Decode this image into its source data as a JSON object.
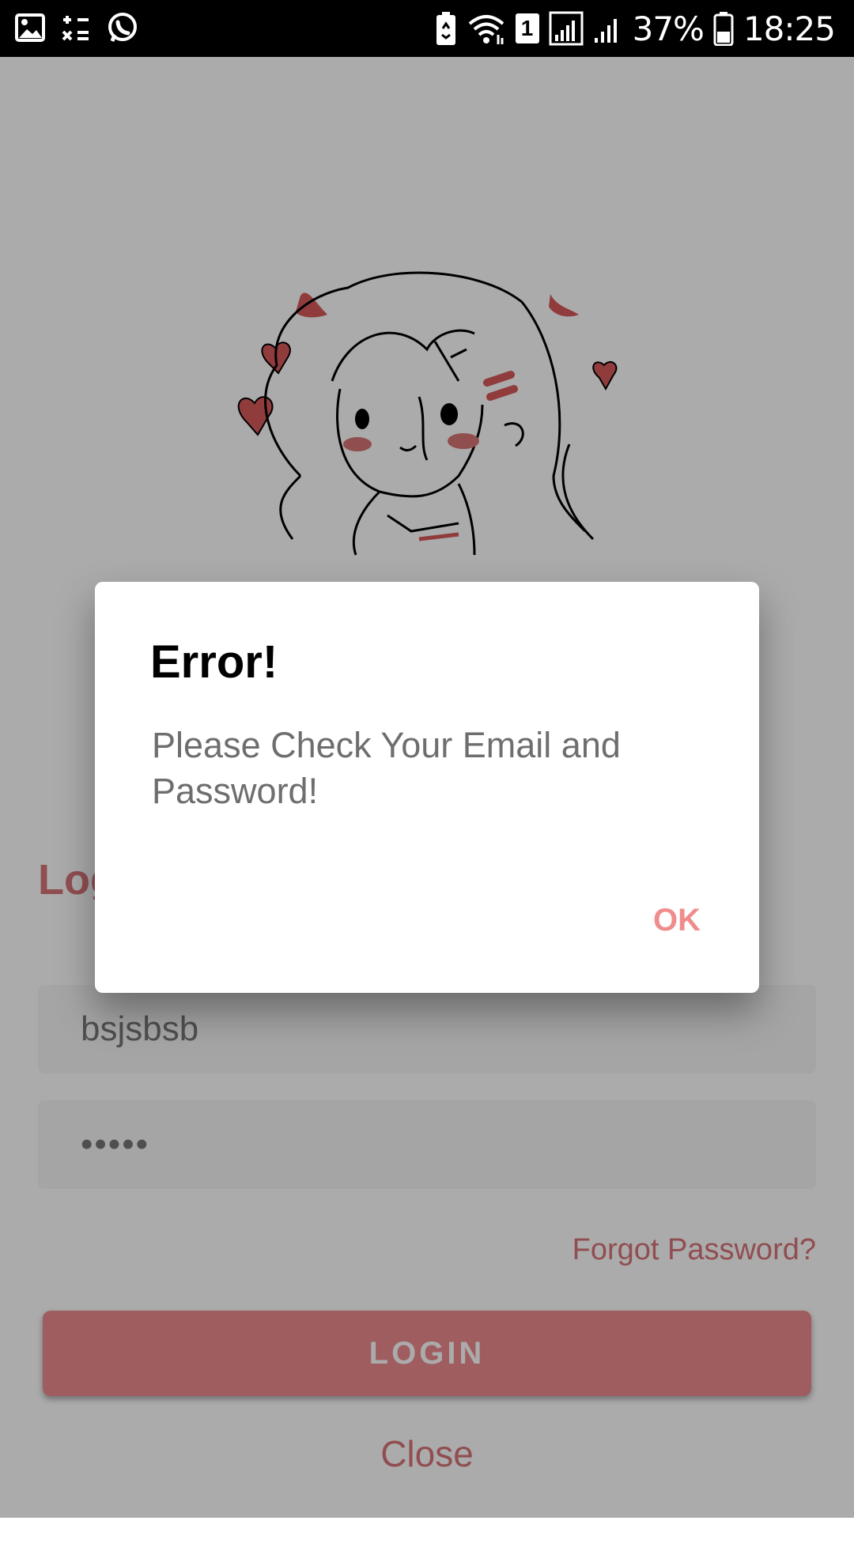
{
  "status_bar": {
    "battery_percent": "37%",
    "time": "18:25",
    "sim_badge": "1",
    "left_icons": [
      "image-icon",
      "calculator-icon",
      "whatsapp-icon"
    ],
    "right_icons": [
      "recycle-battery-icon",
      "wifi-icon",
      "sim-icon",
      "signal-icon",
      "signal-icon-2",
      "battery-icon"
    ]
  },
  "login_sheet": {
    "title": "Login",
    "email_value": "bsjsbsb",
    "password_value": "•••••",
    "forgot_password": "Forgot Password?",
    "login_button": "LOGIN",
    "close": "Close"
  },
  "dialog": {
    "title": "Error!",
    "message": "Please Check Your Email and Password!",
    "ok": "OK"
  },
  "colors": {
    "accent": "#EF8B8F",
    "accent_text": "#D9757A",
    "scrim": "rgba(0,0,0,0.33)",
    "heart": "#D95A5A"
  }
}
